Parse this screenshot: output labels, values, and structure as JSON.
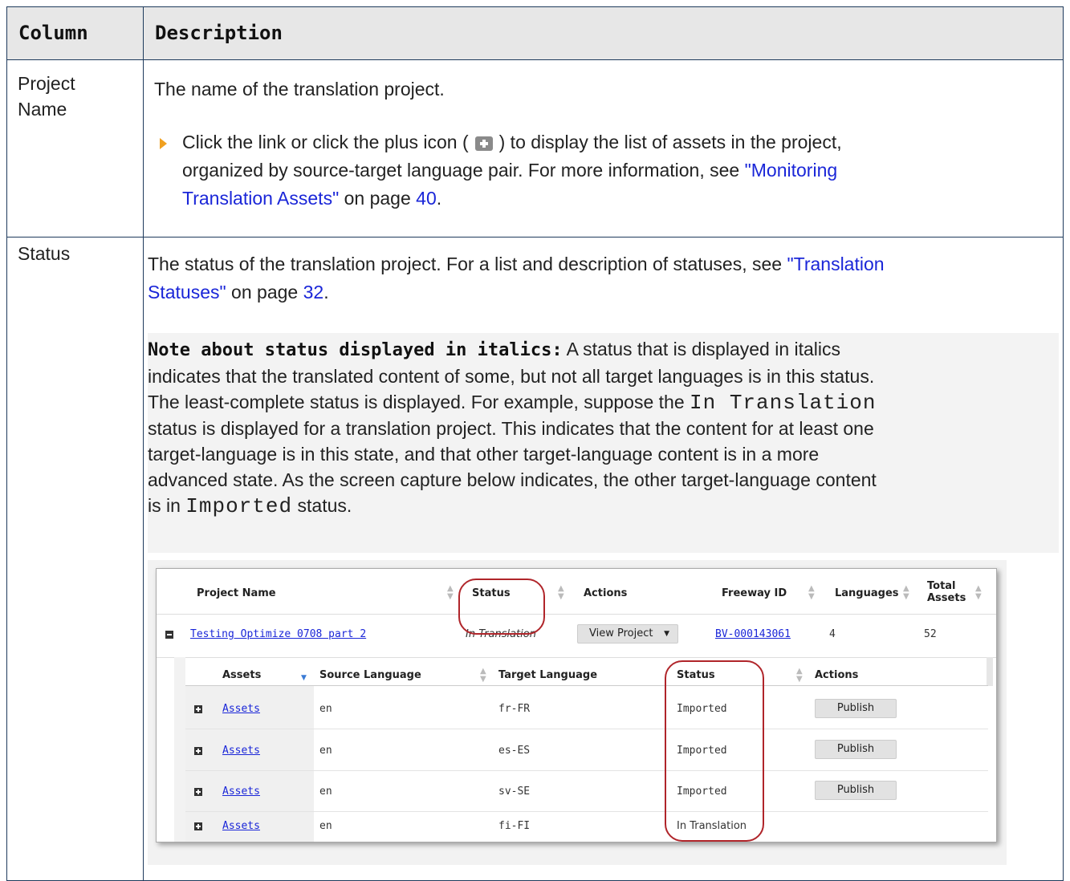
{
  "header": {
    "col1": "Column",
    "col2": "Description"
  },
  "row1": {
    "label": "Project Name",
    "p1": "The name of the translation project.",
    "bullet_a": "Click the link or click the plus icon (",
    "bullet_b": ") to display the list of assets in the project,",
    "bullet_c": "organized by source-target language pair. For more information, see",
    "link1": "\"Monitoring",
    "link2": "Translation Assets\"",
    "on_page": " on page ",
    "page": "40",
    "end": "."
  },
  "row2": {
    "label": "Status",
    "line1_a": "The status of the translation project. For a list and description of statuses, see ",
    "link_a": "\"Translation",
    "link_b": "Statuses\"",
    "on_page": " on page ",
    "page": "32",
    "end": ".",
    "note": {
      "head": "Note about status displayed in italics:",
      "l1": " A status that is displayed in italics",
      "l2": "indicates that the translated content of some, but not all target languages is in this status.",
      "l3a": "The least-complete status is displayed. For example, suppose the ",
      "code1": "In Translation",
      "l4": "status is displayed for a translation project. This indicates that the content for at least one",
      "l5": "target-language is in this state, and that other target-language content is in a more",
      "l6": "advanced state. As the screen capture below indicates, the other target-language content",
      "l7a": "is in ",
      "code2": "Imported",
      "l7b": " status."
    }
  },
  "shot": {
    "headers": {
      "project_name": "Project Name",
      "status": "Status",
      "actions": "Actions",
      "freeway_id": "Freeway ID",
      "languages": "Languages",
      "total_1": "Total",
      "total_2": "Assets"
    },
    "project": {
      "name": "Testing Optimize 0708 part 2",
      "status": "In Translation",
      "action": "View Project",
      "freeway_id": "BV-000143061",
      "languages": "4",
      "total": "52"
    },
    "sub_headers": {
      "assets": "Assets",
      "source": "Source Language",
      "target": "Target Language",
      "status": "Status",
      "actions": "Actions"
    },
    "rows": [
      {
        "assets": "Assets",
        "source": "en",
        "target": "fr-FR",
        "status": "Imported",
        "action": "Publish"
      },
      {
        "assets": "Assets",
        "source": "en",
        "target": "es-ES",
        "status": "Imported",
        "action": "Publish"
      },
      {
        "assets": "Assets",
        "source": "en",
        "target": "sv-SE",
        "status": "Imported",
        "action": "Publish"
      },
      {
        "assets": "Assets",
        "source": "en",
        "target": "fi-FI",
        "status": "In Translation",
        "action": ""
      }
    ],
    "highlight_color": "#b0252a"
  }
}
